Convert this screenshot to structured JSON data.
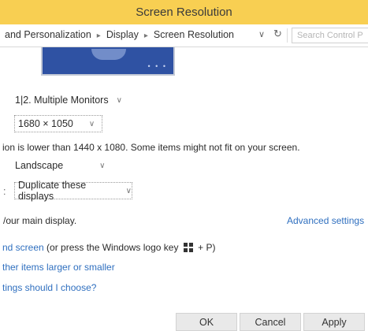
{
  "window": {
    "title": "Screen Resolution"
  },
  "address": {
    "crumbs": [
      "and Personalization",
      "Display",
      "Screen Resolution"
    ],
    "separator": "▸",
    "dropdown_glyph": "∨",
    "refresh_glyph": "↻",
    "search_placeholder": "Search Control P"
  },
  "preview": {
    "dots": "• • •"
  },
  "settings": {
    "display_value": "1|2. Multiple Monitors",
    "resolution_value": "1680 × 1050",
    "warning": "ion is lower than 1440 x 1080. Some items might not fit on your screen.",
    "orientation_value": "Landscape",
    "multiple_label": ":",
    "multiple_value": "Duplicate these displays",
    "main_display": "/our main display.",
    "advanced_link": "Advanced settings",
    "chevron": "∨"
  },
  "links": {
    "project_link": "nd screen",
    "project_rest_prefix": " (or press the Windows logo key ",
    "project_rest_suffix": " + P)",
    "larger_link": "ther items larger or smaller",
    "choose_link": "tings should I choose?"
  },
  "buttons": {
    "ok": "OK",
    "cancel": "Cancel",
    "apply": "Apply"
  },
  "colors": {
    "title_bar": "#f8cf52",
    "link": "#2f6fbf",
    "preview_blue": "#2f52a3"
  }
}
